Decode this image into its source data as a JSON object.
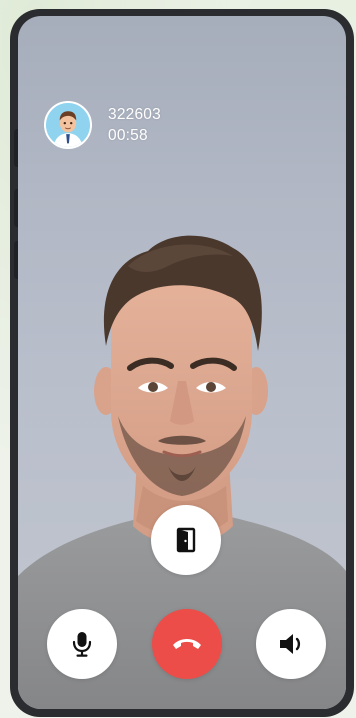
{
  "call": {
    "caller_id": "322603",
    "duration": "00:58"
  },
  "controls": {
    "leave_icon": "door-exit-icon",
    "mic_icon": "microphone-icon",
    "end_icon": "hang-up-icon",
    "speaker_icon": "speaker-icon"
  },
  "colors": {
    "end_call": "#ec4d49",
    "phone_frame": "#2a2c2f",
    "button_bg": "#ffffff"
  }
}
